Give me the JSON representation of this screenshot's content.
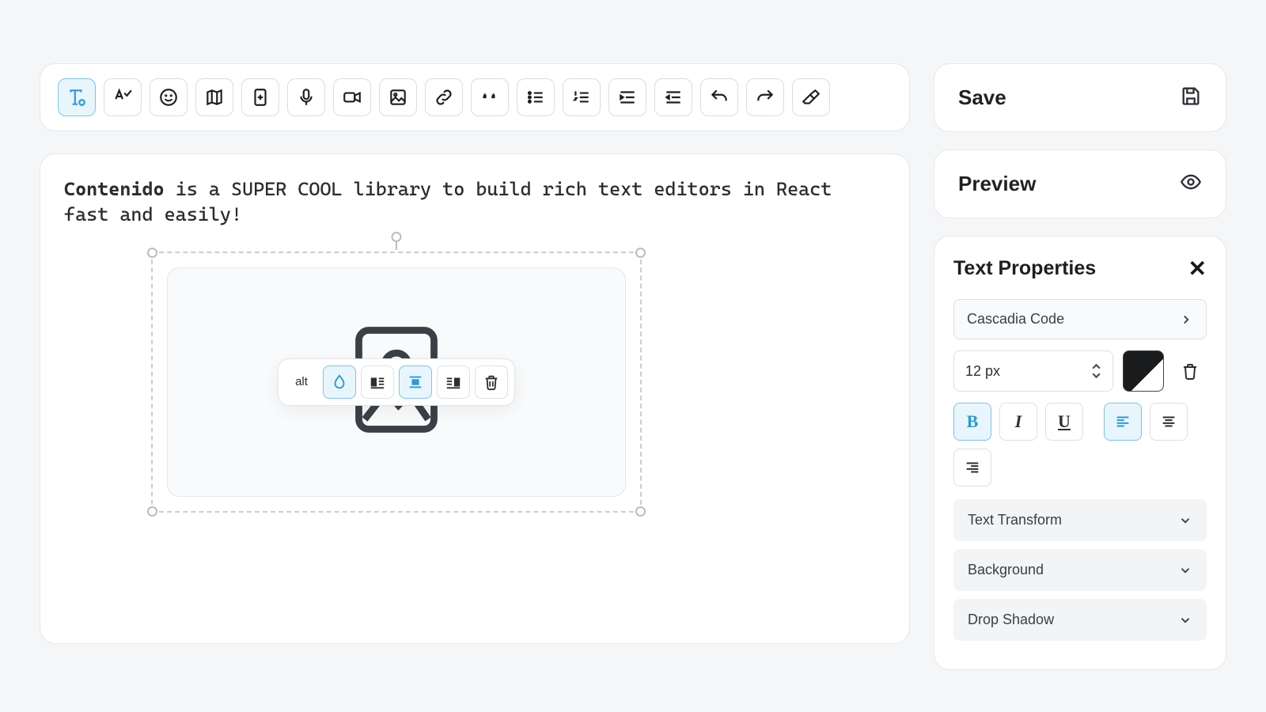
{
  "toolbar": {
    "items": [
      {
        "id": "text-tool",
        "active": true
      },
      {
        "id": "spellcheck"
      },
      {
        "id": "emoji"
      },
      {
        "id": "map"
      },
      {
        "id": "file"
      },
      {
        "id": "mic"
      },
      {
        "id": "video"
      },
      {
        "id": "image"
      },
      {
        "id": "link"
      },
      {
        "id": "quote"
      },
      {
        "id": "bullet-list"
      },
      {
        "id": "numbered-list"
      },
      {
        "id": "indent-increase"
      },
      {
        "id": "indent-decrease"
      },
      {
        "id": "undo"
      },
      {
        "id": "redo"
      },
      {
        "id": "eraser"
      }
    ]
  },
  "editor": {
    "strong": "Contenido",
    "rest": " is a SUPER COOL library to build rich text editors in React fast and easily!"
  },
  "float_toolbar": {
    "alt_label": "alt"
  },
  "right": {
    "save_label": "Save",
    "preview_label": "Preview",
    "props_title": "Text Properties",
    "font_family": "Cascadia Code",
    "font_size": "12 px",
    "bold": "B",
    "italic": "I",
    "underline": "U",
    "collapse1": "Text Transform",
    "collapse2": "Background",
    "collapse3": "Drop Shadow"
  }
}
